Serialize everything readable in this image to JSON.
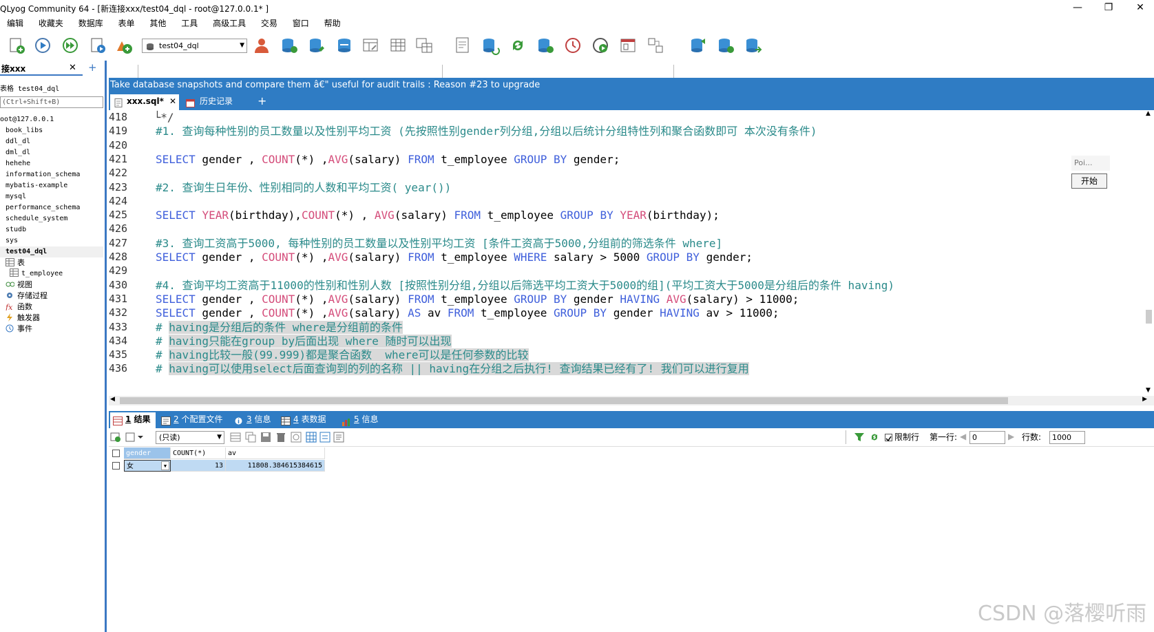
{
  "window": {
    "title": "QLyog Community 64 - [新连接xxx/test04_dql - root@127.0.0.1* ]"
  },
  "menu": [
    "编辑",
    "收藏夹",
    "数据库",
    "表单",
    "其他",
    "工具",
    "高级工具",
    "交易",
    "窗口",
    "帮助"
  ],
  "toolbar": {
    "db_select": "test04_dql"
  },
  "left_panel": {
    "conn_tab": "接xxx",
    "table_line": "表格 test04_dql",
    "filter_placeholder": "(Ctrl+Shift+B)",
    "host": "oot@127.0.0.1",
    "databases": [
      "book_libs",
      "ddl_dl",
      "dml_dl",
      "hehehe",
      "information_schema",
      "mybatis-example",
      "mysql",
      "performance_schema",
      "schedule_system",
      "studb",
      "sys",
      "test04_dql"
    ],
    "db_children": [
      "表",
      "t_employee",
      "视图",
      "存储过程",
      "函数",
      "触发器",
      "事件"
    ]
  },
  "banner": "Take database snapshots and compare them â€\" useful for audit trails : Reason #23 to upgrade",
  "editor_tabs": [
    "xxx.sql*",
    "历史记录"
  ],
  "editor": {
    "lines": [
      {
        "n": "418",
        "t": " └*/"
      },
      {
        "n": "419",
        "t": "#1. 查询每种性别的员工数量以及性别平均工资 (先按照性别gender列分组,分组以后统计分组特性列和聚合函数即可 本次没有条件)"
      },
      {
        "n": "420",
        "t": ""
      },
      {
        "n": "421",
        "t": "SELECT gender , COUNT(*) ,AVG(salary) FROM t_employee GROUP BY gender;"
      },
      {
        "n": "422",
        "t": ""
      },
      {
        "n": "423",
        "t": "#2. 查询生日年份、性别相同的人数和平均工资( year())"
      },
      {
        "n": "424",
        "t": ""
      },
      {
        "n": "425",
        "t": "SELECT YEAR(birthday),COUNT(*) , AVG(salary) FROM t_employee GROUP BY YEAR(birthday);"
      },
      {
        "n": "426",
        "t": ""
      },
      {
        "n": "427",
        "t": "#3. 查询工资高于5000, 每种性别的员工数量以及性别平均工资 [条件工资高于5000,分组前的筛选条件 where]"
      },
      {
        "n": "428",
        "t": "SELECT gender , COUNT(*) ,AVG(salary) FROM t_employee WHERE salary > 5000 GROUP BY gender;"
      },
      {
        "n": "429",
        "t": ""
      },
      {
        "n": "430",
        "t": "#4. 查询平均工资高于11000的性别和性别人数 [按照性别分组,分组以后筛选平均工资大于5000的组](平均工资大于5000是分组后的条件 having)"
      },
      {
        "n": "431",
        "t": "SELECT gender , COUNT(*) ,AVG(salary) FROM t_employee GROUP BY gender HAVING AVG(salary) > 11000;"
      },
      {
        "n": "432",
        "t": "SELECT gender , COUNT(*) ,AVG(salary) AS av FROM t_employee GROUP BY gender HAVING av > 11000;"
      },
      {
        "n": "433",
        "t": "# having是分组后的条件 where是分组前的条件"
      },
      {
        "n": "434",
        "t": "# having只能在group by后面出现 where 随时可以出现"
      },
      {
        "n": "435",
        "t": "# having比较一般(99.999)都是聚合函数  where可以是任何参数的比较"
      },
      {
        "n": "436",
        "t": "# having可以使用select后面查询到的列的名称 || having在分组之后执行! 查询结果已经有了! 我们可以进行复用"
      }
    ]
  },
  "float_panel": {
    "poi": "Poi...",
    "start": "开始"
  },
  "result_tabs": [
    {
      "num": "1",
      "label": "结果"
    },
    {
      "num": "2",
      "label": "个配置文件"
    },
    {
      "num": "3",
      "label": "信息"
    },
    {
      "num": "4",
      "label": "表数据"
    },
    {
      "num": "5",
      "label": "信息"
    }
  ],
  "result_toolbar": {
    "mode": "(只读)",
    "limit_label": "限制行",
    "first_row_label": "第一行:",
    "first_row": "0",
    "rows_label": "行数:",
    "rows": "1000"
  },
  "result_grid": {
    "columns": [
      "gender",
      "COUNT(*)",
      "av"
    ],
    "rows": [
      [
        "女",
        "13",
        "11808.384615384615"
      ]
    ]
  },
  "watermark": "CSDN @落樱听雨",
  "colors": {
    "accent": "#2f7cc4",
    "comment": "#2a8a8a",
    "keyword": "#3f5fdb",
    "function": "#d44c7a"
  }
}
